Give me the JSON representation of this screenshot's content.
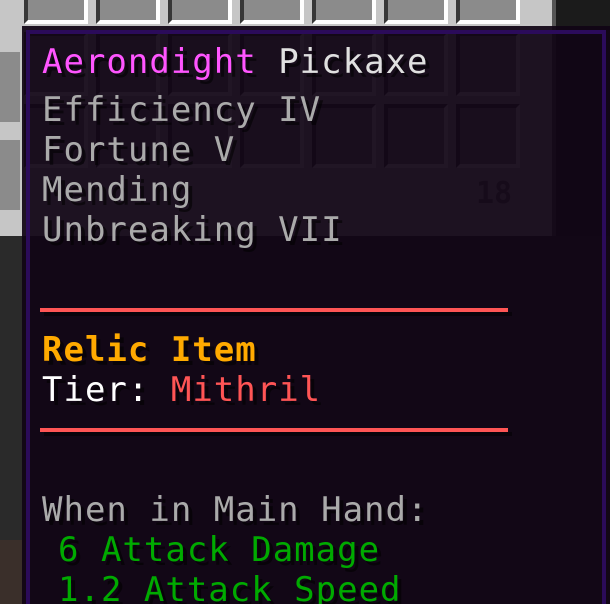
{
  "background": {
    "stack_count": "18"
  },
  "tooltip": {
    "item_name": {
      "rarity_word": "Aerondight",
      "item_type": "Pickaxe"
    },
    "enchantments": [
      "Efficiency IV",
      "Fortune V",
      "Mending",
      "Unbreaking VII"
    ],
    "relic_label": "Relic Item",
    "tier_label": "Tier:",
    "tier_value": "Mithril",
    "main_hand_header": "When in Main Hand:",
    "stats": [
      "6 Attack Damage",
      "1.2 Attack Speed"
    ]
  },
  "colors": {
    "name_rarity": "#ff55ff",
    "name_text": "#e0e0e0",
    "enchantment": "#aaaaaa",
    "relic": "#ffaa00",
    "tier_value": "#ff5555",
    "divider": "#ff5555",
    "stat": "#00aa00",
    "tooltip_border": "#2b0b5a"
  }
}
